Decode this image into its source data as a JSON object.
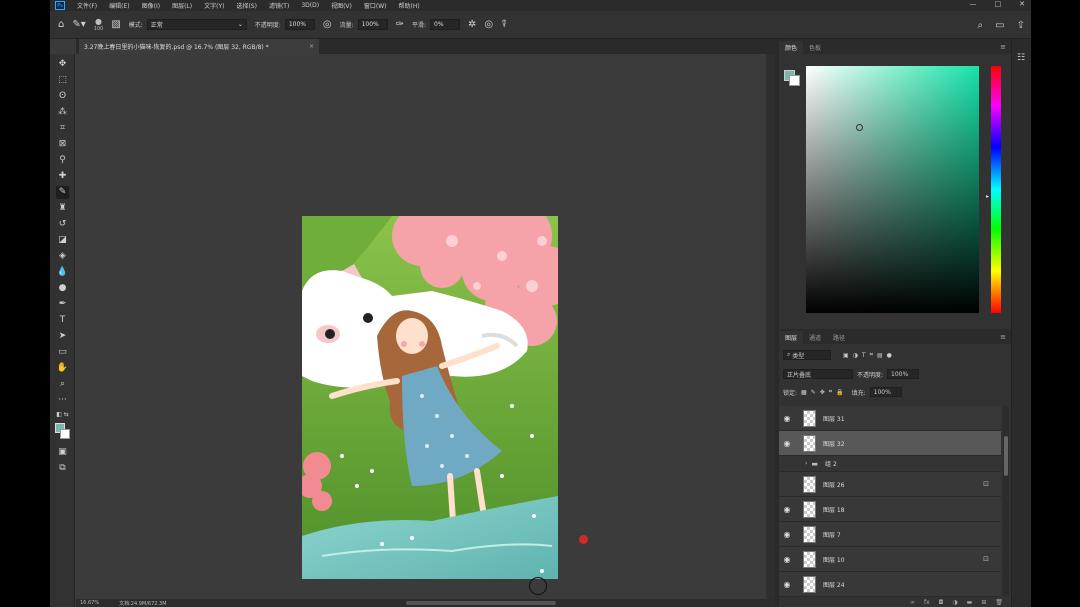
{
  "menubar": {
    "logo": "Ps",
    "items": [
      "文件(F)",
      "编辑(E)",
      "图像(I)",
      "图层(L)",
      "文字(Y)",
      "选择(S)",
      "滤镜(T)",
      "3D(D)",
      "视图(V)",
      "窗口(W)",
      "帮助(H)"
    ],
    "controls": [
      "—",
      "□",
      "✕"
    ]
  },
  "options": {
    "brush_size": "100",
    "mode_label": "模式:",
    "mode_value": "正常",
    "opacity_label": "不透明度:",
    "opacity_value": "100%",
    "flow_label": "流量:",
    "flow_value": "100%",
    "smooth_label": "平滑:",
    "smooth_value": "0%"
  },
  "document": {
    "tab_title": "3.27晚上春日里的小猫咪-恢复的.psd @ 16.7% (图层 32, RGB/8) *",
    "close": "×"
  },
  "status": {
    "zoom": "16.67%",
    "doc_info": "文档:24.9M/672.3M"
  },
  "color_panel": {
    "tabs": [
      "颜色",
      "色板"
    ],
    "menu": "≡",
    "fg_color": "#7ab6a9",
    "bg_color": "#ffffff"
  },
  "layers_panel": {
    "tabs": [
      "图层",
      "通道",
      "路径"
    ],
    "menu": "≡",
    "filter_kind": "类型",
    "blend_mode": "正片叠底",
    "opacity_label": "不透明度:",
    "opacity_value": "100%",
    "lock_label": "锁定:",
    "fill_label": "填充:",
    "fill_value": "100%",
    "layers": [
      {
        "name": "图层 31",
        "visible": true,
        "locked": false,
        "kind": "layer"
      },
      {
        "name": "图层 32",
        "visible": true,
        "locked": false,
        "kind": "layer",
        "selected": true
      },
      {
        "name": "组 2",
        "visible": false,
        "locked": false,
        "kind": "group"
      },
      {
        "name": "图层 26",
        "visible": false,
        "locked": true,
        "kind": "layer"
      },
      {
        "name": "图层 18",
        "visible": true,
        "locked": false,
        "kind": "layer"
      },
      {
        "name": "图层 7",
        "visible": true,
        "locked": false,
        "kind": "layer"
      },
      {
        "name": "图层 10",
        "visible": true,
        "locked": true,
        "kind": "layer"
      },
      {
        "name": "图层 24",
        "visible": true,
        "locked": false,
        "kind": "layer"
      }
    ]
  }
}
